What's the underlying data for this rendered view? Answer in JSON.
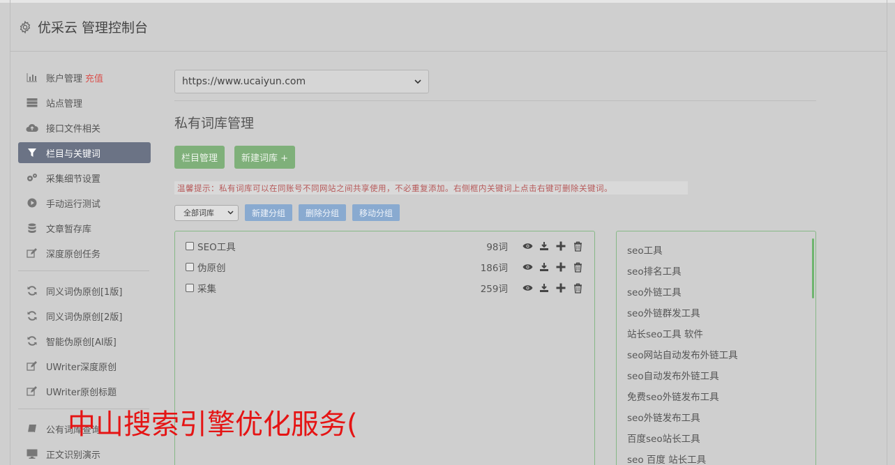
{
  "header": {
    "title": "优采云 管理控制台"
  },
  "sidebar": {
    "group1": [
      {
        "label": "账户管理",
        "extra": "充值",
        "icon": "bar-chart-icon"
      },
      {
        "label": "站点管理",
        "icon": "server-icon"
      },
      {
        "label": "接口文件相关",
        "icon": "cloud-upload-icon"
      },
      {
        "label": "栏目与关键词",
        "icon": "filter-icon",
        "active": true
      },
      {
        "label": "采集细节设置",
        "icon": "cogs-icon"
      },
      {
        "label": "手动运行测试",
        "icon": "play-circle-icon"
      },
      {
        "label": "文章暂存库",
        "icon": "database-icon"
      },
      {
        "label": "深度原创任务",
        "icon": "edit-icon"
      }
    ],
    "group2": [
      {
        "label": "同义词伪原创[1版]",
        "icon": "refresh-icon"
      },
      {
        "label": "同义词伪原创[2版]",
        "icon": "refresh-icon"
      },
      {
        "label": "智能伪原创[AI版]",
        "icon": "refresh-icon"
      },
      {
        "label": "UWriter深度原创",
        "icon": "edit-icon"
      },
      {
        "label": "UWriter原创标题",
        "icon": "edit-icon"
      }
    ],
    "group3": [
      {
        "label": "公有词库查询",
        "icon": "book-icon"
      },
      {
        "label": "正文识别演示",
        "icon": "monitor-icon"
      }
    ]
  },
  "main": {
    "site_select": "https://www.ucaiyun.com",
    "page_title": "私有词库管理",
    "btn_column": "栏目管理",
    "btn_new_lib": "新建词库 +",
    "tip": "温馨提示：私有词库可以在同账号不同网站之间共享使用，不必重复添加。右侧框内关键词上点击右键可删除关键词。",
    "lib_select": "全部词库",
    "btn_new_group": "新建分组",
    "btn_del_group": "删除分组",
    "btn_move_group": "移动分组",
    "groups": [
      {
        "name": "SEO工具",
        "count": "98词"
      },
      {
        "name": "伪原创",
        "count": "186词"
      },
      {
        "name": "采集",
        "count": "259词"
      }
    ],
    "keywords": [
      "seo工具",
      "seo排名工具",
      "seo外链工具",
      "seo外链群发工具",
      "站长seo工具 软件",
      "seo网站自动发布外链工具",
      "seo自动发布外链工具",
      "免费seo外链发布工具",
      "seo外链发布工具",
      "百度seo站长工具",
      "seo 百度 站长工具"
    ]
  },
  "overlay_text": "中山搜索引擎优化服务(",
  "colors": {
    "active_nav": "#6b7385",
    "green_button": "#7fb07a",
    "blue_button": "#89aad0",
    "charge": "#d9534f",
    "overlay": "#e51414"
  }
}
